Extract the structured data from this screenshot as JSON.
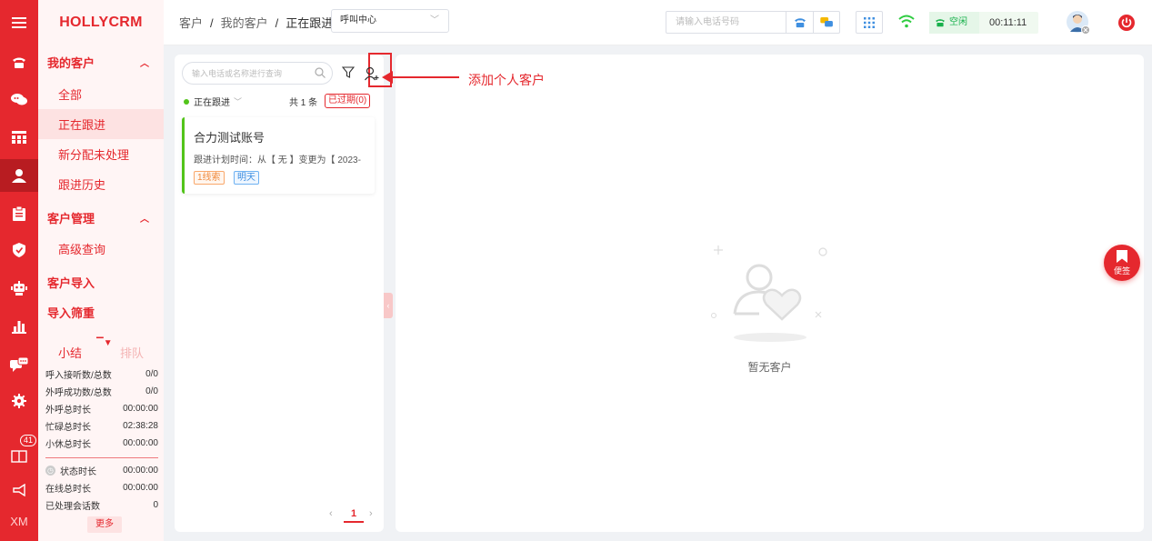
{
  "app": {
    "title": "HOLLYCRM"
  },
  "rail": {
    "icons": [
      "menu-icon",
      "telephone-icon",
      "chat-bubbles-icon",
      "grid-icon",
      "user-icon",
      "clipboard-icon",
      "shield-icon",
      "robot-icon",
      "bar-chart-icon",
      "message-icon",
      "gear-icon",
      "book-icon",
      "megaphone-icon"
    ],
    "badge_count": "41",
    "footer_label": "XM",
    "active": "user-icon"
  },
  "sidebar": {
    "group_my_customers": "我的客户",
    "items_my": [
      "全部",
      "正在跟进",
      "新分配未处理",
      "跟进历史"
    ],
    "active_item": "正在跟进",
    "group_customer_mgmt": "客户管理",
    "items_mgmt": [
      "高级查询"
    ],
    "group_import": "客户导入",
    "group_filter": "导入筛重",
    "stats_tabs": [
      "小结",
      "排队"
    ],
    "stats": [
      {
        "label": "呼入接听数/总数",
        "value": "0/0"
      },
      {
        "label": "外呼成功数/总数",
        "value": "0/0"
      },
      {
        "label": "外呼总时长",
        "value": "00:00:00"
      },
      {
        "label": "忙碌总时长",
        "value": "02:38:28"
      },
      {
        "label": "小休总时长",
        "value": "00:00:00"
      },
      {
        "label": "状态时长",
        "value": "00:00:00"
      },
      {
        "label": "在线总时长",
        "value": "00:00:00"
      },
      {
        "label": "已处理会话数",
        "value": "0"
      }
    ],
    "more_label": "更多"
  },
  "header": {
    "breadcrumb": [
      "客户",
      "我的客户",
      "正在跟进"
    ],
    "channel_select": "呼叫中心",
    "phone_placeholder": "请输入电话号码",
    "status_label": "空闲",
    "timer": "00:11:11"
  },
  "list": {
    "search_placeholder": "输入电话或名称进行查询",
    "status_filter": "正在跟进",
    "count_text": "共 1 条",
    "expired_label": "已过期(0)",
    "cards": [
      {
        "name": "合力测试账号",
        "plan": "跟进计划时间：从【 无 】变更为【 2023-",
        "tags": [
          "1线索",
          "明天"
        ]
      }
    ],
    "page": "1"
  },
  "detail": {
    "empty_text": "暂无客户"
  },
  "annotation": {
    "text": "添加个人客户"
  },
  "bookmark": {
    "label": "便签"
  },
  "colors": {
    "brand_red": "#e5282e",
    "active_green": "#52c41a",
    "status_green": "#17b04b"
  }
}
